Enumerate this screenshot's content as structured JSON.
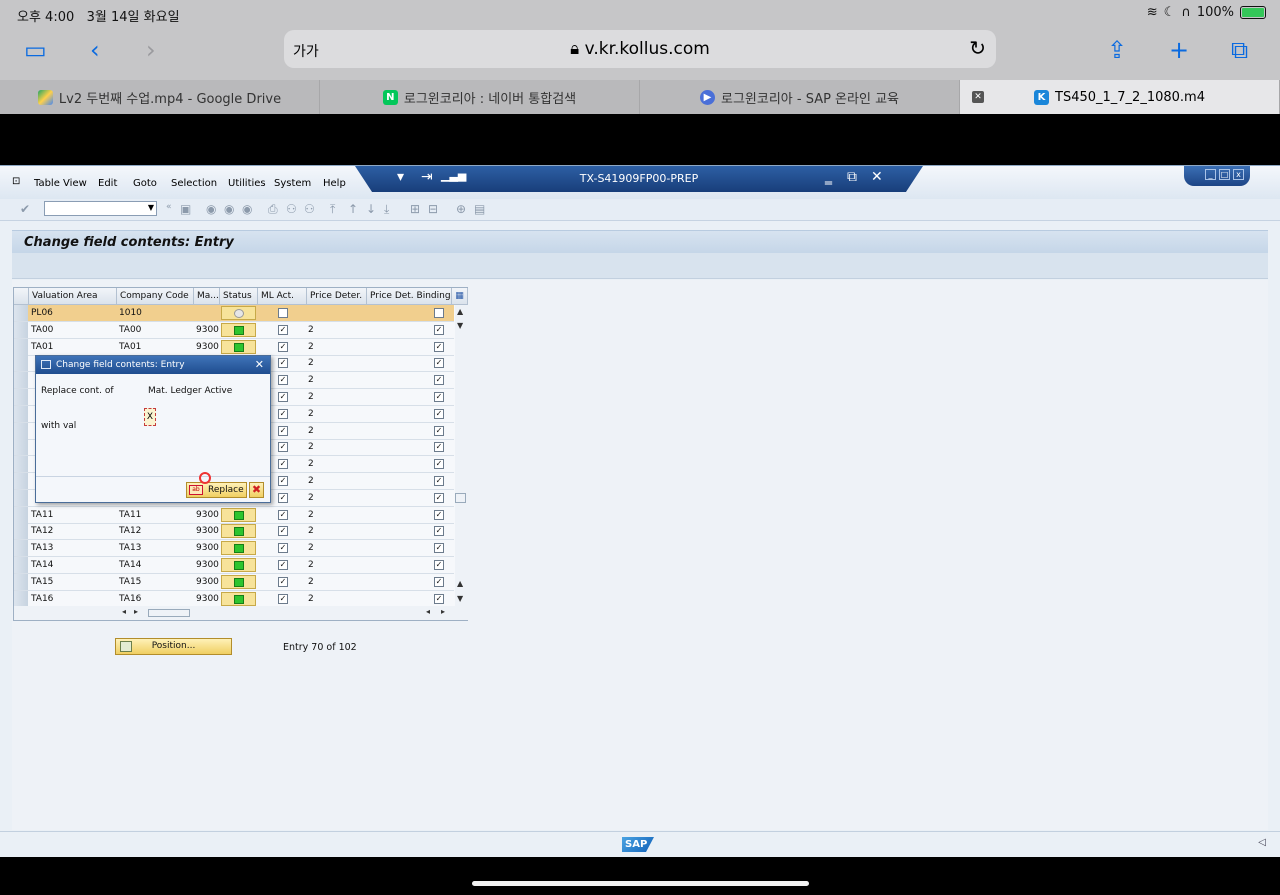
{
  "ipad": {
    "time": "오후 4:00",
    "date": "3월 14일 화요일",
    "battery": "100%",
    "icons": [
      "wifi-icon",
      "moon-icon",
      "headphones-icon",
      "battery-icon"
    ]
  },
  "browser": {
    "text_size_label": "가가",
    "url": "v.kr.kollus.com",
    "tabs": [
      {
        "label": "Lv2 두번째 수업.mp4 - Google Drive",
        "icon": "google-drive-icon"
      },
      {
        "label": "로그윈코리아 : 네이버 통합검색",
        "icon": "naver-icon"
      },
      {
        "label": "로그윈코리아 - SAP 온라인 교육",
        "icon": "play-icon"
      },
      {
        "label": "TS450_1_7_2_1080.m4",
        "icon": "kollus-icon"
      }
    ]
  },
  "sap": {
    "menu": [
      "Table View",
      "Edit",
      "Goto",
      "Selection",
      "Utilities",
      "System",
      "Help"
    ],
    "system_title": "TX-S41909FP00-PREP",
    "screen_title": "Change field contents: Entry",
    "columns": [
      "Valuation Area",
      "Company Code",
      "Ma...",
      "Status",
      "ML Act.",
      "Price Deter.",
      "Price Det. Binding i"
    ],
    "rows": [
      {
        "va": "PL06",
        "cc": "1010",
        "ma": "",
        "status": "inactive",
        "ml": false,
        "pd": "",
        "pdb": false,
        "selected": true
      },
      {
        "va": "TA00",
        "cc": "TA00",
        "ma": "9300",
        "status": "active",
        "ml": true,
        "pd": "2",
        "pdb": true
      },
      {
        "va": "TA01",
        "cc": "TA01",
        "ma": "9300",
        "status": "active",
        "ml": true,
        "pd": "2",
        "pdb": true
      },
      {
        "va": "",
        "cc": "",
        "ma": "",
        "status": "",
        "ml": true,
        "pd": "2",
        "pdb": true
      },
      {
        "va": "",
        "cc": "",
        "ma": "",
        "status": "",
        "ml": true,
        "pd": "2",
        "pdb": true
      },
      {
        "va": "",
        "cc": "",
        "ma": "",
        "status": "",
        "ml": true,
        "pd": "2",
        "pdb": true
      },
      {
        "va": "",
        "cc": "",
        "ma": "",
        "status": "",
        "ml": true,
        "pd": "2",
        "pdb": true
      },
      {
        "va": "",
        "cc": "",
        "ma": "",
        "status": "",
        "ml": true,
        "pd": "2",
        "pdb": true
      },
      {
        "va": "",
        "cc": "",
        "ma": "",
        "status": "",
        "ml": true,
        "pd": "2",
        "pdb": true
      },
      {
        "va": "",
        "cc": "",
        "ma": "",
        "status": "",
        "ml": true,
        "pd": "2",
        "pdb": true
      },
      {
        "va": "",
        "cc": "",
        "ma": "",
        "status": "",
        "ml": true,
        "pd": "2",
        "pdb": true
      },
      {
        "va": "",
        "cc": "",
        "ma": "",
        "status": "",
        "ml": true,
        "pd": "2",
        "pdb": true
      },
      {
        "va": "TA11",
        "cc": "TA11",
        "ma": "9300",
        "status": "active",
        "ml": true,
        "pd": "2",
        "pdb": true
      },
      {
        "va": "TA12",
        "cc": "TA12",
        "ma": "9300",
        "status": "active",
        "ml": true,
        "pd": "2",
        "pdb": true
      },
      {
        "va": "TA13",
        "cc": "TA13",
        "ma": "9300",
        "status": "active",
        "ml": true,
        "pd": "2",
        "pdb": true
      },
      {
        "va": "TA14",
        "cc": "TA14",
        "ma": "9300",
        "status": "active",
        "ml": true,
        "pd": "2",
        "pdb": true
      },
      {
        "va": "TA15",
        "cc": "TA15",
        "ma": "9300",
        "status": "active",
        "ml": true,
        "pd": "2",
        "pdb": true
      },
      {
        "va": "TA16",
        "cc": "TA16",
        "ma": "9300",
        "status": "active",
        "ml": true,
        "pd": "2",
        "pdb": true
      }
    ],
    "position_button": "Position...",
    "entry_info": "Entry 70 of 102",
    "logo": "SAP"
  },
  "dialog": {
    "title": "Change field contents: Entry",
    "replace_label": "Replace cont. of",
    "field_name": "Mat. Ledger Active",
    "with_label": "with val",
    "value": "X",
    "replace_button": "Replace"
  }
}
